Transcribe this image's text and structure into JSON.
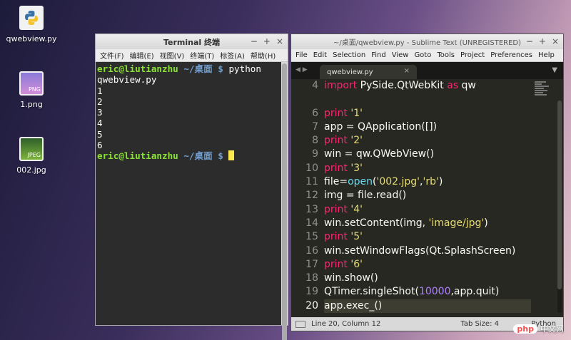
{
  "desktop": {
    "icons": [
      {
        "label": "qwebview.py",
        "icon": "python-file-icon"
      },
      {
        "label": "1.png",
        "icon": "png-image-icon",
        "badge": "PNG"
      },
      {
        "label": "002.jpg",
        "icon": "jpeg-image-icon",
        "badge": "JPEG"
      }
    ]
  },
  "terminal": {
    "title": "Terminal 终端",
    "window_buttons": [
      "−",
      "+",
      "×"
    ],
    "menu": [
      "文件(F)",
      "编辑(E)",
      "视图(V)",
      "终端(T)",
      "标签(A)",
      "帮助(H)"
    ],
    "prompt_user": "eric@liutianzhu",
    "prompt_path": "~/桌面",
    "prompt_symbol": "$",
    "command": "python",
    "command_wrap": "qwebview.py",
    "output": [
      "1",
      "2",
      "3",
      "4",
      "5",
      "6"
    ]
  },
  "sublime": {
    "title": "~/桌面/qwebview.py - Sublime Text (UNREGISTERED)",
    "window_buttons": [
      "−",
      "+",
      "×"
    ],
    "menu": [
      "File",
      "Edit",
      "Selection",
      "Find",
      "View",
      "Goto",
      "Tools",
      "Project",
      "Preferences",
      "Help"
    ],
    "tab": {
      "label": "qwebview.py",
      "close": "×"
    },
    "line_numbers": [
      "4",
      "",
      "6",
      "7",
      "8",
      "9",
      "10",
      "11",
      "12",
      "13",
      "14",
      "15",
      "16",
      "17",
      "18",
      "19",
      "20"
    ],
    "code": {
      "l4": {
        "kw": "import",
        "rest": " PySide.QtWebKit ",
        "kw2": "as",
        "rest2": " qw"
      },
      "l6": {
        "kw": "print",
        "str": " '1'"
      },
      "l7": "app = QApplication([])",
      "l8": {
        "kw": "print",
        "str": " '2'"
      },
      "l9": "win = qw.QWebView()",
      "l10": {
        "kw": "print",
        "str": " '3'"
      },
      "l11": {
        "pre": "file=",
        "fn": "open",
        "mid": "(",
        "str1": "'002.jpg'",
        "comma": ",",
        "str2": "'rb'",
        "end": ")"
      },
      "l12": "img = file.read()",
      "l13": {
        "kw": "print",
        "str": " '4'"
      },
      "l14": {
        "pre": "win.setContent(img, ",
        "str": "'image/jpg'",
        "end": ")"
      },
      "l15": {
        "kw": "print",
        "str": " '5'"
      },
      "l16": "win.setWindowFlags(Qt.SplashScreen)",
      "l17": {
        "kw": "print",
        "str": " '6'"
      },
      "l18": "win.show()",
      "l19": {
        "pre": "QTimer.singleShot(",
        "num": "10000",
        "end": ",app.quit)"
      },
      "l20": "app.exec_()"
    },
    "status": {
      "position": "Line 20, Column 12",
      "tab_size": "Tab Size: 4",
      "syntax": "Python"
    }
  },
  "watermark": {
    "logo": "php",
    "text": "中文网"
  }
}
